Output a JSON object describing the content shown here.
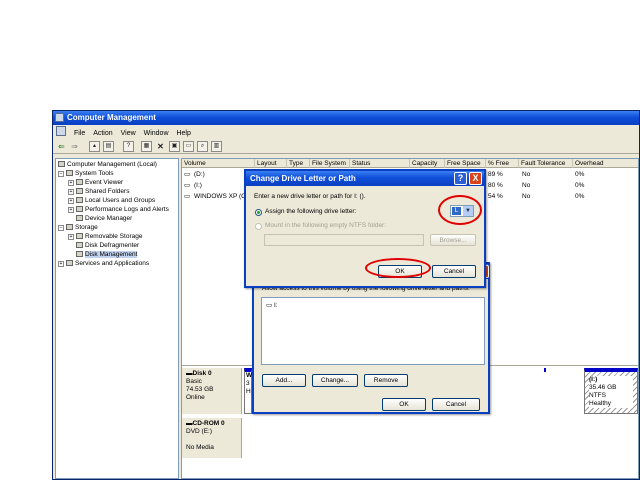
{
  "window": {
    "title": "Computer Management",
    "menu": [
      "File",
      "Action",
      "View",
      "Window",
      "Help"
    ]
  },
  "tree": {
    "root": "Computer Management (Local)",
    "system_tools": "System Tools",
    "event_viewer": "Event Viewer",
    "shared_folders": "Shared Folders",
    "local_users": "Local Users and Groups",
    "perf_logs": "Performance Logs and Alerts",
    "device_manager": "Device Manager",
    "storage": "Storage",
    "removable": "Removable Storage",
    "defrag": "Disk Defragmenter",
    "disk_mgmt": "Disk Management",
    "services": "Services and Applications"
  },
  "volume_list": {
    "columns": [
      "Volume",
      "Layout",
      "Type",
      "File System",
      "Status",
      "Capacity",
      "Free Space",
      "% Free",
      "Fault Tolerance",
      "Overhead"
    ],
    "rows": [
      {
        "volume": "(D:)",
        "pct_free": "89 %",
        "fault": "No",
        "overhead": "0%"
      },
      {
        "volume": "(I:)",
        "pct_free": "80 %",
        "fault": "No",
        "overhead": "0%"
      },
      {
        "volume": "WINDOWS XP (C",
        "pct_free": "54 %",
        "fault": "No",
        "overhead": "0%"
      }
    ]
  },
  "disks": {
    "disk0": {
      "name": "Disk 0",
      "type": "Basic",
      "size": "74.53 GB",
      "status": "Online"
    },
    "cdrom0": {
      "name": "CD-ROM 0",
      "type": "DVD (E:)",
      "status": "No Media"
    },
    "partition_i": {
      "label": "(I:)",
      "size": "35.46 GB NTFS",
      "status": "Healthy"
    },
    "partial_w": "W",
    "partial_3": "3",
    "partial_h": "H"
  },
  "change_dialog": {
    "title": "Change Drive Letter or Path",
    "prompt": "Enter a new drive letter or path for I: ().",
    "assign_label": "Assign the following drive letter:",
    "drive_letter": "L",
    "mount_label": "Mount in the following empty NTFS folder:",
    "browse": "Browse...",
    "ok": "OK",
    "cancel": "Cancel",
    "help_glyph": "?",
    "close_glyph": "X"
  },
  "paths_dialog": {
    "instruction": "Allow access to this volume by using the following drive letter and paths:",
    "list_item": "I:",
    "add": "Add...",
    "change": "Change...",
    "remove": "Remove",
    "ok": "OK",
    "cancel": "Cancel"
  },
  "colors": {
    "title_blue": "#0a3fc2",
    "dialog_face": "#ece9d8",
    "highlight_red": "#e00000",
    "disk_bar_blue": "#0000c8"
  }
}
